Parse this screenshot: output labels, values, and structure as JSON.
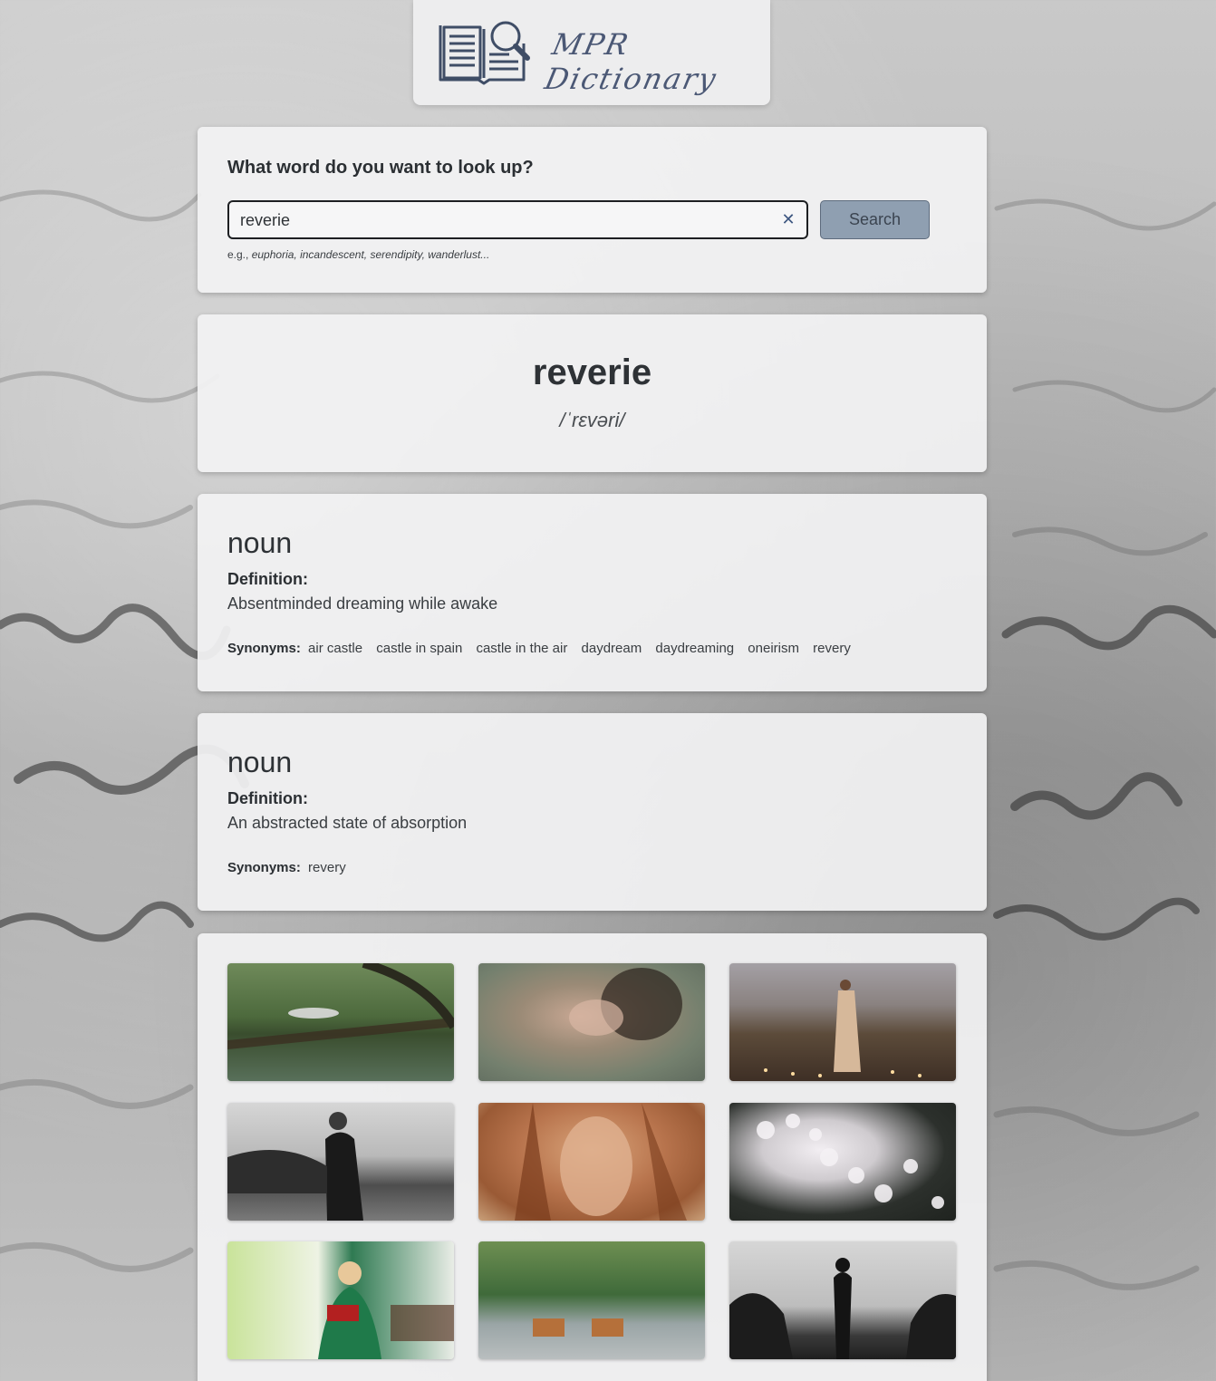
{
  "app": {
    "logo_text": "MPR Dictionary"
  },
  "search": {
    "question": "What word do you want to look up?",
    "value": "reverie",
    "button_label": "Search",
    "clear_symbol": "✕",
    "hint_prefix": "e.g.,",
    "hint_examples": "euphoria, incandescent, serendipity, wanderlust..."
  },
  "word": {
    "title": "reverie",
    "phonetic": "/ˈrɛvəri/"
  },
  "meanings": [
    {
      "part_of_speech": "noun",
      "definition_label": "Definition:",
      "definition": "Absentminded dreaming while awake",
      "synonyms_label": "Synonyms:",
      "synonyms": [
        "air castle",
        "castle in spain",
        "castle in the air",
        "daydream",
        "daydreaming",
        "oneirism",
        "revery"
      ]
    },
    {
      "part_of_speech": "noun",
      "definition_label": "Definition:",
      "definition": "An abstracted state of absorption",
      "synonyms_label": "Synonyms:",
      "synonyms": [
        "revery"
      ]
    }
  ],
  "photos": [
    {
      "subject": "girl lying on fallen tree over pond"
    },
    {
      "subject": "woman with curly hair in blurred water"
    },
    {
      "subject": "woman in long dress standing in reeds"
    },
    {
      "subject": "man in black standing by river"
    },
    {
      "subject": "woman with eyes closed in warm light"
    },
    {
      "subject": "white blossom branches"
    },
    {
      "subject": "person in green hoodie reading a red book"
    },
    {
      "subject": "horses crossing river near forest"
    },
    {
      "subject": "silhouette of man by water"
    }
  ],
  "colors": {
    "accent": "#3d5680",
    "button_bg": "#8f9fb1",
    "card_bg": "#f2f2f3",
    "text": "#2e3236"
  },
  "icons": {
    "logo": "book-magnifier-icon",
    "clear": "close-icon"
  }
}
